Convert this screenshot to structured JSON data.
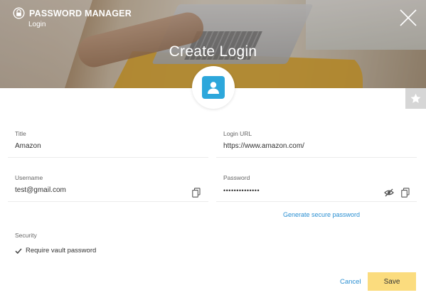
{
  "app": {
    "brand_title": "PASSWORD MANAGER",
    "brand_subtitle": "Login",
    "brand_icon": "lock-shield-icon"
  },
  "header": {
    "page_title": "Create Login",
    "close_icon": "close-icon",
    "avatar_icon": "user-account-icon"
  },
  "favorite": {
    "icon": "star-icon"
  },
  "form": {
    "title": {
      "label": "Title",
      "value": "Amazon"
    },
    "login_url": {
      "label": "Login URL",
      "value": "https://www.amazon.com/"
    },
    "username": {
      "label": "Username",
      "value": "test@gmail.com",
      "copy_icon": "copy-icon"
    },
    "password": {
      "label": "Password",
      "value": "••••••••••••••",
      "hide_icon": "eye-slash-icon",
      "copy_icon": "copy-icon"
    },
    "generate_link": "Generate secure password",
    "security": {
      "label": "Security",
      "require_vault_password": {
        "label": "Require vault password",
        "checked": true
      }
    }
  },
  "actions": {
    "cancel_label": "Cancel",
    "save_label": "Save"
  },
  "colors": {
    "accent": "#2a8fd2",
    "avatar": "#2da7db",
    "save_button": "#fbdc7e",
    "favorite_tab": "#d6d6d6"
  }
}
